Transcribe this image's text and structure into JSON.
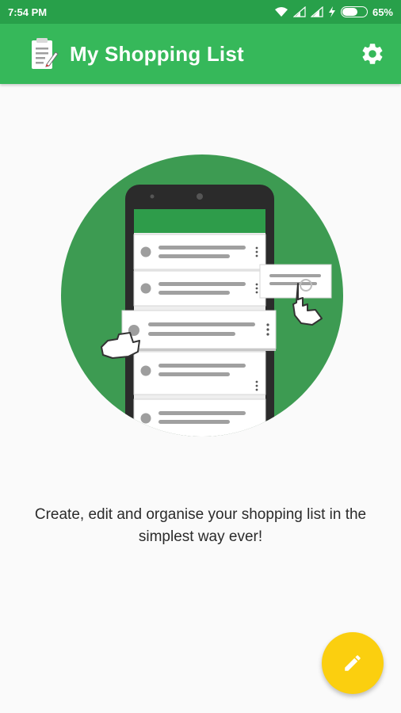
{
  "status_bar": {
    "time": "7:54 PM",
    "battery_percent": "65%",
    "battery_level": 0.65,
    "icons": [
      "wifi-icon",
      "signal-icon",
      "signal-icon",
      "charging-icon",
      "battery-icon"
    ]
  },
  "app_bar": {
    "title": "My Shopping List",
    "logo_icon": "clipboard-icon",
    "settings_icon": "gear-icon"
  },
  "main": {
    "tagline": "Create, edit and organise your shopping list in the simplest way ever!"
  },
  "fab": {
    "icon": "pencil-icon"
  },
  "colors": {
    "status_bar": "#28a04a",
    "app_bar": "#36b85a",
    "circle": "#3d9b52",
    "fab": "#fbcf0f"
  }
}
